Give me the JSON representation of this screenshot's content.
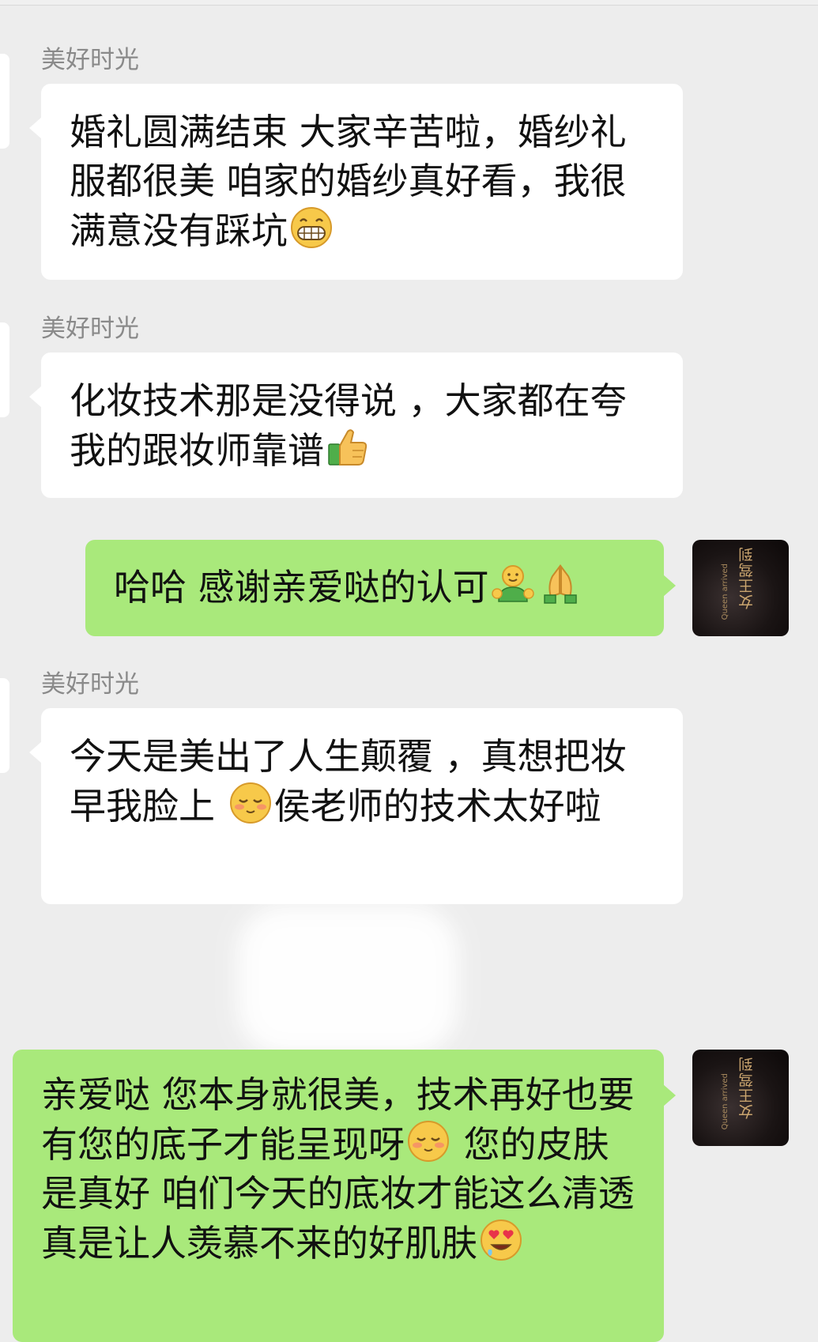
{
  "chat": {
    "messages": [
      {
        "sender": "美好时光",
        "direction": "in",
        "parts": [
          {
            "type": "text",
            "value": "婚礼圆满结束 大家辛苦啦，婚纱礼服都很美 咱家的婚纱真好看，我很满意没有踩坑"
          },
          {
            "type": "emoji",
            "icon": "grin-emoji-icon"
          }
        ]
      },
      {
        "sender": "美好时光",
        "direction": "in",
        "parts": [
          {
            "type": "text",
            "value": "化妆技术那是没得说 ，大家都在夸我的跟妆师靠谱"
          },
          {
            "type": "emoji",
            "icon": "thumbs-up-emoji-icon"
          }
        ]
      },
      {
        "direction": "out",
        "parts": [
          {
            "type": "text",
            "value": "哈哈 感谢亲爱哒的认可"
          },
          {
            "type": "emoji",
            "icon": "hug-emoji-icon"
          },
          {
            "type": "emoji",
            "icon": "pray-emoji-icon"
          }
        ]
      },
      {
        "sender": "美好时光",
        "direction": "in",
        "parts": [
          {
            "type": "text",
            "value": "今天是美出了人生颠覆 ，真想把妆早我脸上 "
          },
          {
            "type": "emoji",
            "icon": "shy-emoji-icon"
          },
          {
            "type": "text",
            "value": "侯老师的技术太好啦"
          }
        ]
      },
      {
        "direction": "out",
        "parts": [
          {
            "type": "text",
            "value": "亲爱哒 您本身就很美，技术再好也要有您的底子才能呈现呀"
          },
          {
            "type": "emoji",
            "icon": "shy-emoji-icon"
          },
          {
            "type": "text",
            "value": " 您的皮肤是真好 咱们今天的底妆才能这么清透  真是让人羡慕不来的好肌肤"
          },
          {
            "type": "emoji",
            "icon": "heart-eyes-emoji-icon"
          }
        ]
      }
    ]
  },
  "avatar": {
    "line1": "女王驾到",
    "line2": "Queen arrived"
  },
  "colors": {
    "background": "#ededed",
    "incoming_bubble": "#ffffff",
    "outgoing_bubble": "#a9e97b",
    "sender_name": "#8a8a8a"
  }
}
